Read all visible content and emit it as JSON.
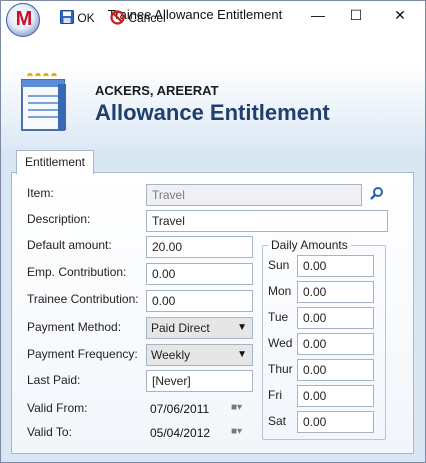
{
  "window": {
    "title": "Trainee Allowance Entitlement",
    "logo_letter": "M",
    "minimize": "—",
    "maximize": "☐",
    "close": "✕"
  },
  "toolbar": {
    "ok_label": "OK",
    "cancel_label": "Cancel"
  },
  "header": {
    "trainee_name": "ACKERS, AREERAT",
    "title": "Allowance Entitlement"
  },
  "tabs": [
    {
      "label": "Entitlement",
      "active": true
    }
  ],
  "form": {
    "item": {
      "label": "Item:",
      "value": "Travel"
    },
    "description": {
      "label": "Description:",
      "value": "Travel"
    },
    "default_amount": {
      "label": "Default amount:",
      "value": "20.00"
    },
    "emp_contribution": {
      "label": "Emp. Contribution:",
      "value": "0.00"
    },
    "trainee_contribution": {
      "label": "Trainee Contribution:",
      "value": "0.00"
    },
    "payment_method": {
      "label": "Payment Method:",
      "value": "Paid Direct"
    },
    "payment_frequency": {
      "label": "Payment Frequency:",
      "value": "Weekly"
    },
    "last_paid": {
      "label": "Last Paid:",
      "value": "[Never]"
    },
    "valid_from": {
      "label": "Valid From:",
      "value": "07/06/2011"
    },
    "valid_to": {
      "label": "Valid To:",
      "value": "05/04/2012"
    }
  },
  "daily_amounts": {
    "title": "Daily Amounts",
    "days": [
      {
        "label": "Sun",
        "value": "0.00"
      },
      {
        "label": "Mon",
        "value": "0.00"
      },
      {
        "label": "Tue",
        "value": "0.00"
      },
      {
        "label": "Wed",
        "value": "0.00"
      },
      {
        "label": "Thur",
        "value": "0.00"
      },
      {
        "label": "Fri",
        "value": "0.00"
      },
      {
        "label": "Sat",
        "value": "0.00"
      }
    ]
  },
  "icons": [
    "app-logo-icon",
    "save-icon",
    "cancel-icon",
    "notepad-icon",
    "search-icon",
    "calendar-icon",
    "chevron-down-icon"
  ]
}
